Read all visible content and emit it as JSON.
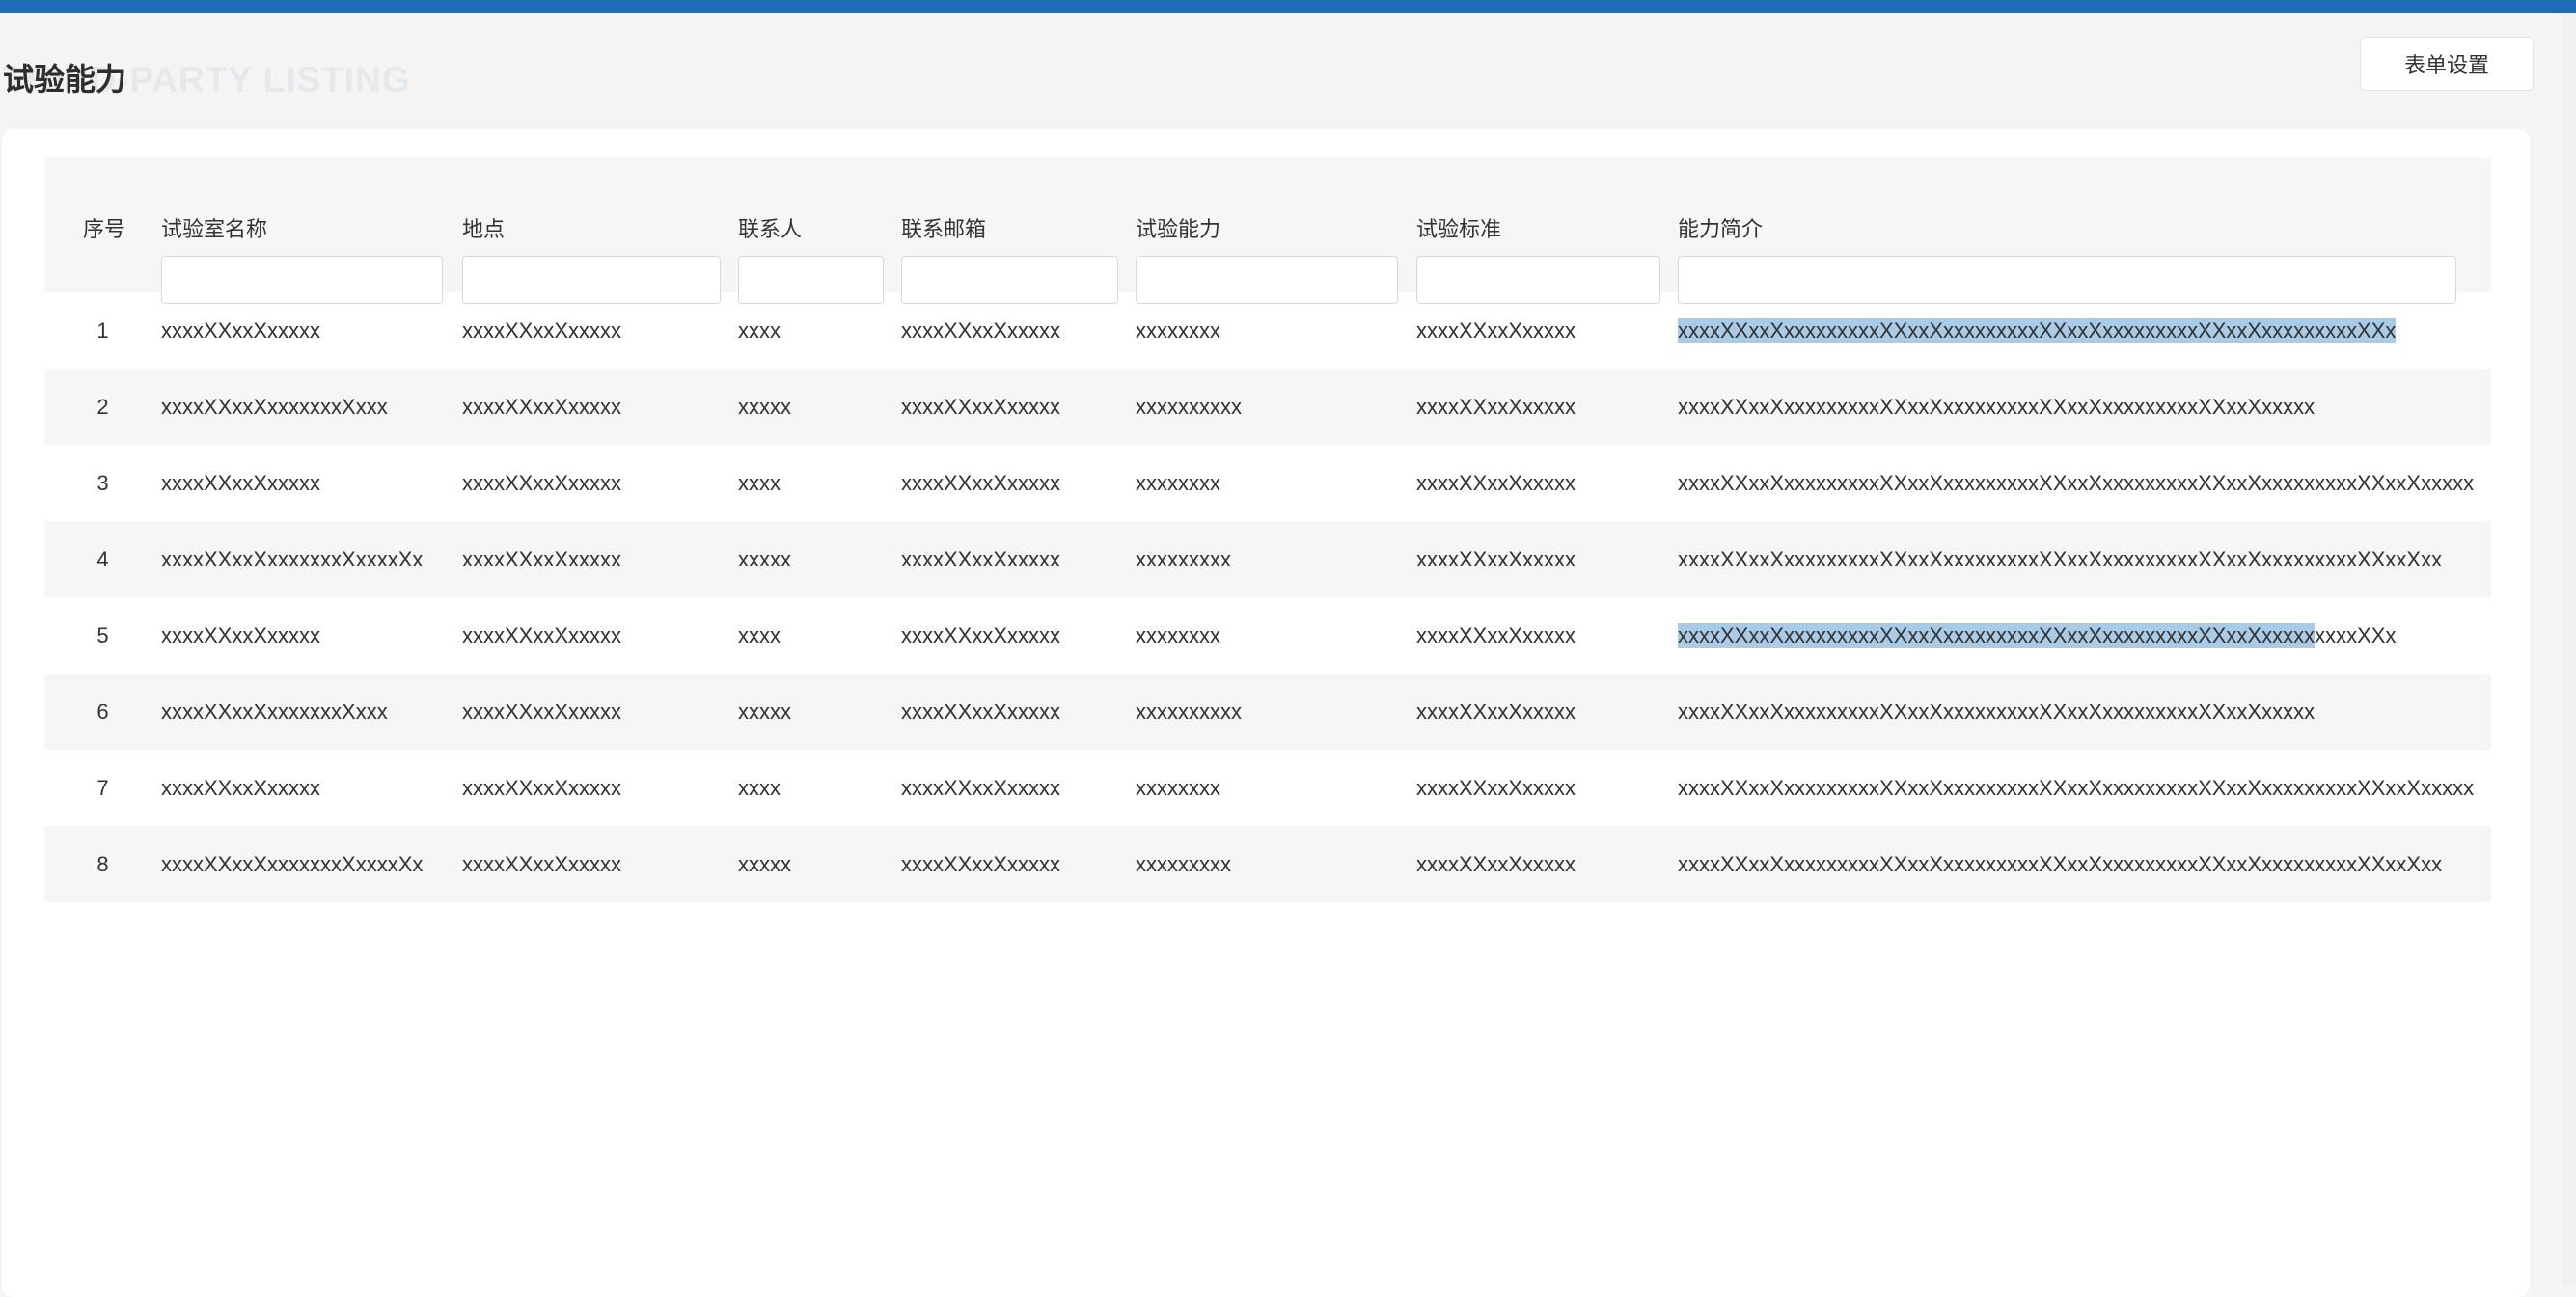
{
  "page": {
    "title": "试验能力",
    "watermark": "THIRD-PARTY LISTING",
    "settings_button": "表单设置"
  },
  "colors": {
    "topbar": "#1e6db7",
    "highlight": "#a9cbe6"
  },
  "table": {
    "headers": [
      "序号",
      "试验室名称",
      "地点",
      "联系人",
      "联系邮箱",
      "试验能力",
      "试验标准",
      "能力简介"
    ],
    "rows": [
      {
        "idx": "1",
        "name": "xxxxXXxxXxxxxx",
        "location": "xxxxXXxxXxxxxx",
        "contact": "xxxx",
        "email": "xxxxXXxxXxxxxx",
        "capability": "xxxxxxxx",
        "standard": "xxxxXXxxXxxxxx",
        "intro_hl": "xxxxXXxxXxxxxxxxxxXXxxXxxxxxxxxxXXxxXxxxxxxxxxXXxxXxxxxxxxxxXXx",
        "intro_rest": ""
      },
      {
        "idx": "2",
        "name": "xxxxXXxxXxxxxxxxXxxx",
        "location": "xxxxXXxxXxxxxx",
        "contact": "xxxxx",
        "email": "xxxxXXxxXxxxxx",
        "capability": "xxxxxxxxxx",
        "standard": "xxxxXXxxXxxxxx",
        "intro_hl": "",
        "intro_rest": "xxxxXXxxXxxxxxxxxxXXxxXxxxxxxxxxXXxxXxxxxxxxxxXXxxXxxxxx"
      },
      {
        "idx": "3",
        "name": "xxxxXXxxXxxxxx",
        "location": "xxxxXXxxXxxxxx",
        "contact": "xxxx",
        "email": "xxxxXXxxXxxxxx",
        "capability": "xxxxxxxx",
        "standard": "xxxxXXxxXxxxxx",
        "intro_hl": "",
        "intro_rest": "xxxxXXxxXxxxxxxxxxXXxxXxxxxxxxxxXXxxXxxxxxxxxxXXxxXxxxxxxxxxXXxxXxxxxx"
      },
      {
        "idx": "4",
        "name": "xxxxXXxxXxxxxxxxXxxxxXx",
        "location": "xxxxXXxxXxxxxx",
        "contact": "xxxxx",
        "email": "xxxxXXxxXxxxxx",
        "capability": "xxxxxxxxx",
        "standard": "xxxxXXxxXxxxxx",
        "intro_hl": "",
        "intro_rest": "xxxxXXxxXxxxxxxxxxXXxxXxxxxxxxxxXXxxXxxxxxxxxxXXxxXxxxxxxxxxXXxxXxx"
      },
      {
        "idx": "5",
        "name": "xxxxXXxxXxxxxx",
        "location": "xxxxXXxxXxxxxx",
        "contact": "xxxx",
        "email": "xxxxXXxxXxxxxx",
        "capability": "xxxxxxxx",
        "standard": "xxxxXXxxXxxxxx",
        "intro_hl": "xxxxXXxxXxxxxxxxxxXXxxXxxxxxxxxxXXxxXxxxxxxxxxXXxxXxxxxx",
        "intro_rest": "xxxxXXx"
      },
      {
        "idx": "6",
        "name": "xxxxXXxxXxxxxxxxXxxx",
        "location": "xxxxXXxxXxxxxx",
        "contact": "xxxxx",
        "email": "xxxxXXxxXxxxxx",
        "capability": "xxxxxxxxxx",
        "standard": "xxxxXXxxXxxxxx",
        "intro_hl": "",
        "intro_rest": "xxxxXXxxXxxxxxxxxxXXxxXxxxxxxxxxXXxxXxxxxxxxxxXXxxXxxxxx"
      },
      {
        "idx": "7",
        "name": "xxxxXXxxXxxxxx",
        "location": "xxxxXXxxXxxxxx",
        "contact": "xxxx",
        "email": "xxxxXXxxXxxxxx",
        "capability": "xxxxxxxx",
        "standard": "xxxxXXxxXxxxxx",
        "intro_hl": "",
        "intro_rest": "xxxxXXxxXxxxxxxxxxXXxxXxxxxxxxxxXXxxXxxxxxxxxxXXxxXxxxxxxxxxXXxxXxxxxx"
      },
      {
        "idx": "8",
        "name": "xxxxXXxxXxxxxxxxXxxxxXx",
        "location": "xxxxXXxxXxxxxx",
        "contact": "xxxxx",
        "email": "xxxxXXxxXxxxxx",
        "capability": "xxxxxxxxx",
        "standard": "xxxxXXxxXxxxxx",
        "intro_hl": "",
        "intro_rest": "xxxxXXxxXxxxxxxxxxXXxxXxxxxxxxxxXXxxXxxxxxxxxxXXxxXxxxxxxxxxXXxxXxx"
      }
    ]
  }
}
